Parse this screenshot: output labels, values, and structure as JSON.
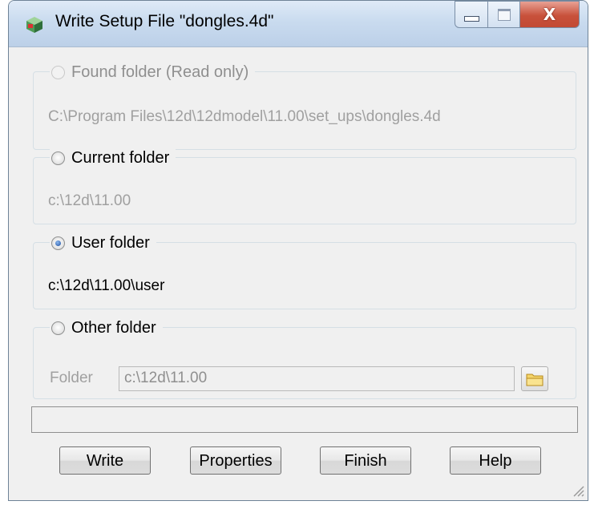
{
  "window": {
    "title": "Write Setup File \"dongles.4d\"",
    "controls": {
      "minimize_icon": "minimize-icon",
      "maximize_icon": "maximize-icon",
      "close_label": "X"
    }
  },
  "groups": {
    "found": {
      "label": "Found folder (Read only)",
      "path": "C:\\Program Files\\12d\\12dmodel\\11.00\\set_ups\\dongles.4d",
      "enabled": false,
      "selected": false
    },
    "current": {
      "label": "Current folder",
      "path": "c:\\12d\\11.00",
      "enabled": true,
      "selected": false
    },
    "user": {
      "label": "User folder",
      "path": "c:\\12d\\11.00\\user",
      "enabled": true,
      "selected": true
    },
    "other": {
      "label": "Other folder",
      "folder_label": "Folder",
      "folder_value": "c:\\12d\\11.00",
      "enabled": true,
      "selected": false
    }
  },
  "status_text": "",
  "buttons": {
    "write": "Write",
    "properties": "Properties",
    "finish": "Finish",
    "help": "Help"
  },
  "colors": {
    "accent": "#1d4d9d",
    "disabled_text": "#a0a0a0",
    "close_button": "#c8513b"
  }
}
